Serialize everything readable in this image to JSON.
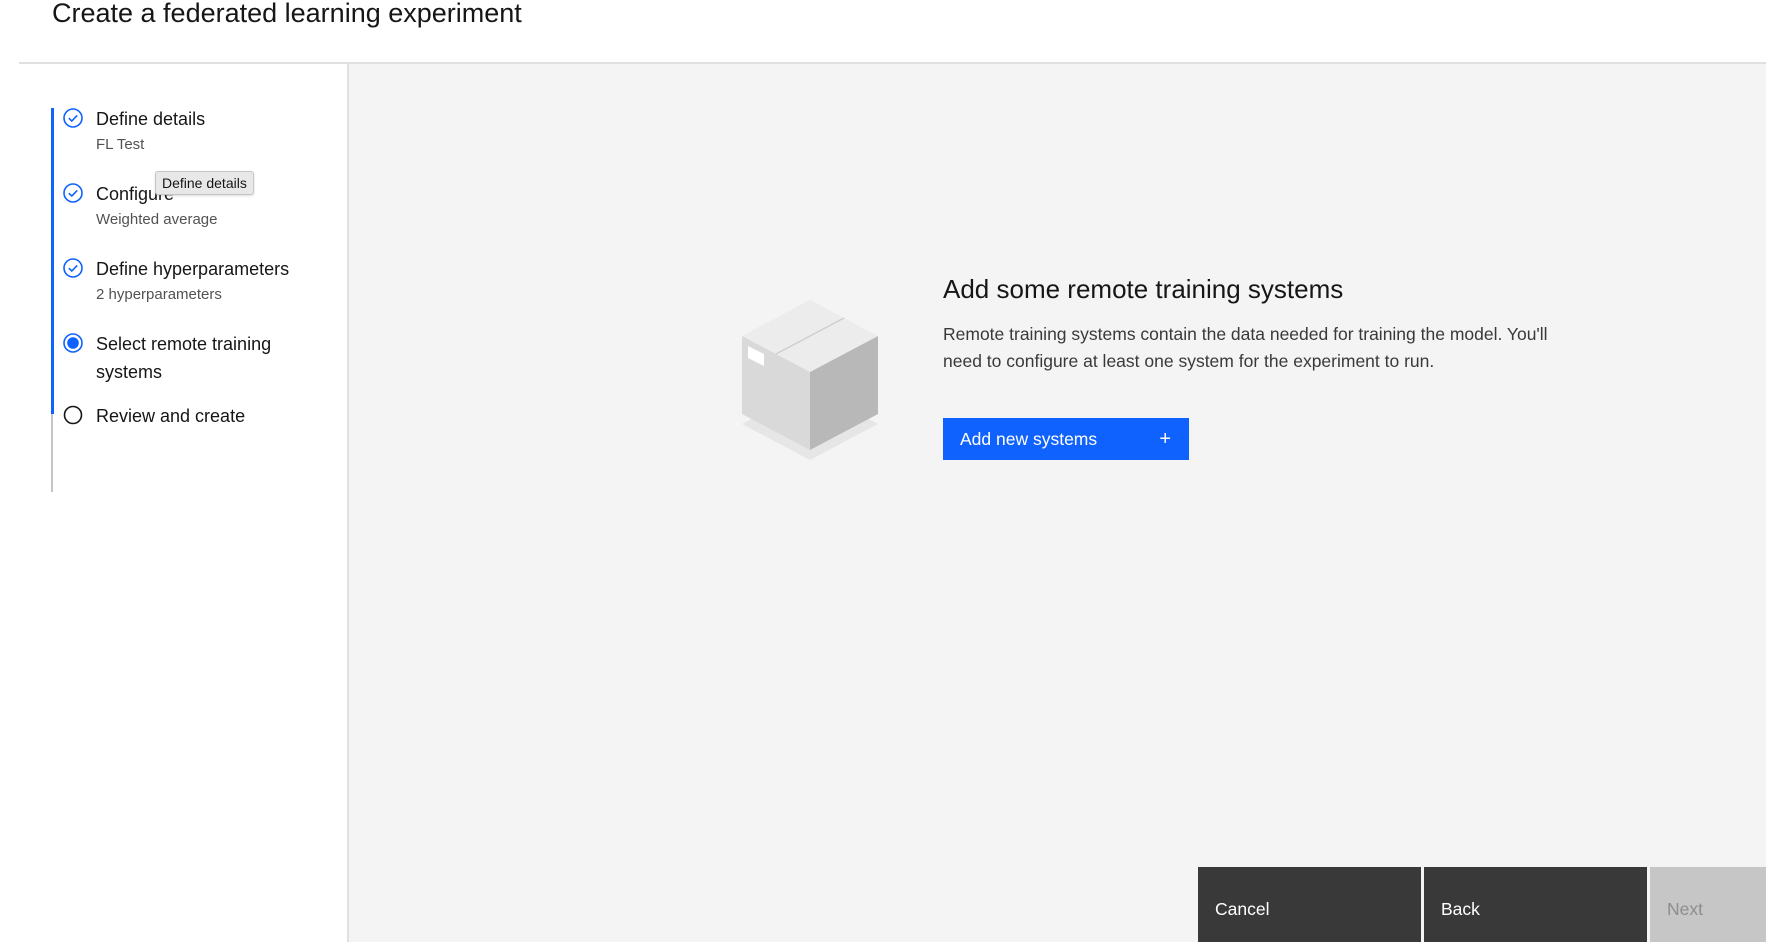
{
  "page": {
    "title": "Create a federated learning experiment"
  },
  "steps": [
    {
      "label": "Define details",
      "sub": "FL Test",
      "status": "complete"
    },
    {
      "label": "Configure",
      "sub": "Weighted average",
      "status": "complete"
    },
    {
      "label": "Define hyperparameters",
      "sub": "2 hyperparameters",
      "status": "complete"
    },
    {
      "label": "Select remote training systems",
      "sub": "",
      "status": "current"
    },
    {
      "label": "Review and create",
      "sub": "",
      "status": "incomplete"
    }
  ],
  "tooltip": {
    "text": "Define details"
  },
  "empty_state": {
    "title": "Add some remote training systems",
    "description": "Remote training systems contain the data needed for training the model. You'll need to configure at least one system for the experiment to run.",
    "button_label": "Add new systems",
    "button_icon": "plus-icon"
  },
  "footer": {
    "cancel": "Cancel",
    "back": "Back",
    "next": "Next"
  },
  "colors": {
    "accent": "#0f62fe",
    "footer_bg": "#393939",
    "disabled_bg": "#c6c6c6",
    "main_bg": "#f4f4f4"
  }
}
